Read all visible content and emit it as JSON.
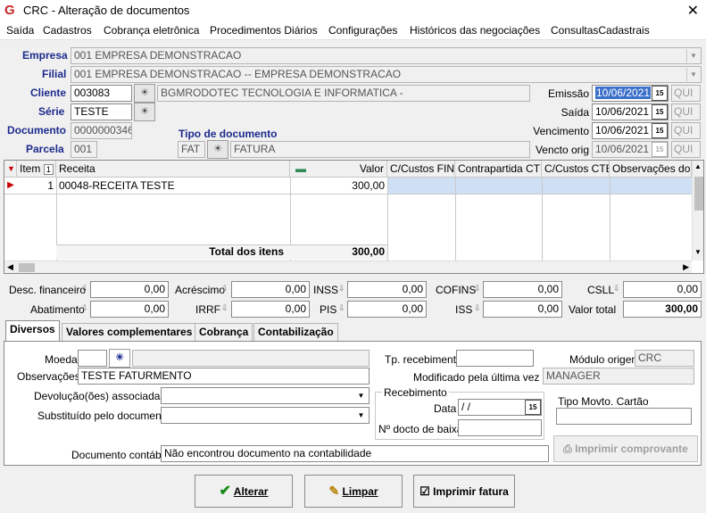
{
  "window": {
    "title": "CRC - Alteração de documentos",
    "close_glyph": "✕"
  },
  "menu": [
    "Saída",
    "Cadastros",
    "Cobrança eletrônica",
    "Procedimentos Diários",
    "Configurações",
    "Históricos das negociações",
    "ConsultasCadastrais"
  ],
  "header": {
    "empresa_label": "Empresa",
    "empresa_value": "001 EMPRESA DEMONSTRACAO",
    "filial_label": "Filial",
    "filial_value": "001 EMPRESA DEMONSTRACAO -- EMPRESA DEMONSTRACAO",
    "cliente_label": "Cliente",
    "cliente_code": "003083",
    "cliente_name": "BGMRODOTEC TECNOLOGIA  E INFORMATICA -",
    "serie_label": "Série",
    "serie_value": "TESTE",
    "documento_label": "Documento",
    "documento_value": "0000000346",
    "parcela_label": "Parcela",
    "parcela_value": "001",
    "tipo_doc_label": "Tipo de documento",
    "tipo_doc_code": "FAT",
    "tipo_doc_name": "FATURA",
    "emissao_label": "Emissão",
    "emissao_value": "10/06/2021",
    "emissao_day": "QUI",
    "saida_label": "Saída",
    "saida_value": "10/06/2021",
    "saida_day": "QUI",
    "vencimento_label": "Vencimento",
    "vencimento_value": "10/06/2021",
    "vencimento_day": "QUI",
    "vencto_orig_label": "Vencto orig",
    "vencto_orig_value": "10/06/2021",
    "vencto_orig_day": "QUI",
    "calendar_glyph": "15"
  },
  "grid": {
    "columns": [
      "Item",
      "Receita",
      "Valor",
      "C/Custos FIN",
      "Contrapartida CTB",
      "C/Custos CTB",
      "Observações do ite"
    ],
    "sort_badge": "1",
    "rows": [
      {
        "item": "1",
        "receita": "00048-RECEITA TESTE",
        "valor": "300,00"
      }
    ],
    "total_label": "Total dos itens",
    "total_value": "300,00"
  },
  "totals": {
    "desc_financeiro_label": "Desc. financeiro",
    "desc_financeiro": "0,00",
    "acrescimo_label": "Acréscimo",
    "acrescimo": "0,00",
    "inss_label": "INSS",
    "inss": "0,00",
    "cofins_label": "COFINS",
    "cofins": "0,00",
    "csll_label": "CSLL",
    "csll": "0,00",
    "abatimento_label": "Abatimento",
    "abatimento": "0,00",
    "irrf_label": "IRRF",
    "irrf": "0,00",
    "pis_label": "PIS",
    "pis": "0,00",
    "iss_label": "ISS",
    "iss": "0,00",
    "valor_total_label": "Valor total",
    "valor_total": "300,00"
  },
  "tabs": [
    "Diversos",
    "Valores complementares",
    "Cobrança",
    "Contabilização"
  ],
  "diversos": {
    "moeda_label": "Moeda",
    "moeda_value": "",
    "observacoes_label": "Observações",
    "observacoes_value": "TESTE FATURMENTO",
    "devolucoes_label": "Devolução(ões) associada(s)",
    "devolucoes_value": "",
    "substituido_label": "Substituído pelo documento",
    "substituido_value": "",
    "tp_recebimento_label": "Tp. recebimento",
    "tp_recebimento_value": "",
    "modulo_origem_label": "Módulo origem",
    "modulo_origem_value": "CRC",
    "modificado_label": "Modificado pela última vez por",
    "modificado_value": "MANAGER",
    "recebimento_group": "Recebimento",
    "data_label": "Data",
    "data_value": " /  /",
    "docto_baixa_label": "Nº docto de baixa",
    "docto_baixa_value": "",
    "tipo_movto_label": "Tipo Movto. Cartão",
    "tipo_movto_value": "",
    "doc_contabil_label": "Documento contábil",
    "doc_contabil_value": "Não encontrou documento na contabilidade",
    "imprimir_comprovante": "Imprimir comprovante"
  },
  "buttons": {
    "alterar": "Alterar",
    "limpar": "Limpar",
    "imprimir_fatura": "Imprimir fatura"
  },
  "colors": {
    "accent_label": "#1c2a8c",
    "selection": "#3b6fc9",
    "brand_icon": "#c62828"
  }
}
